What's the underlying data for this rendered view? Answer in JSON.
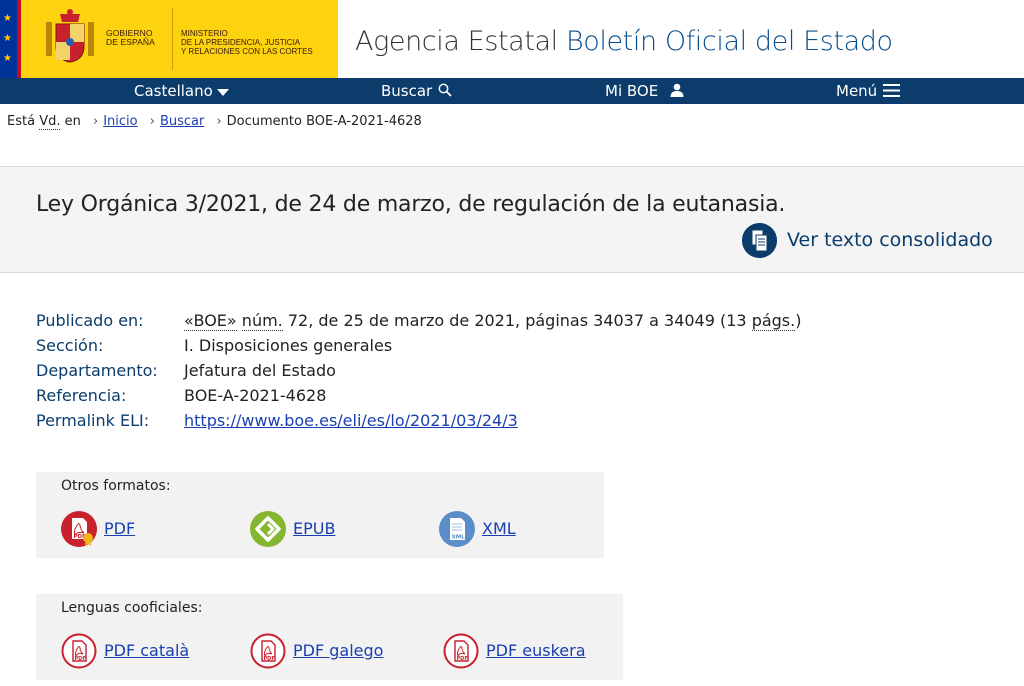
{
  "header": {
    "gobierno": [
      "GOBIERNO",
      "DE ESPAÑA"
    ],
    "ministerio": [
      "MINISTERIO",
      "DE LA PRESIDENCIA, JUSTICIA",
      "Y RELACIONES CON LAS CORTES"
    ],
    "title_plain": "Agencia Estatal ",
    "title_blue": "Boletín Oficial del Estado"
  },
  "nav": {
    "language": "Castellano",
    "search": "Buscar",
    "my_boe": "Mi BOE",
    "menu": "Menú"
  },
  "breadcrumb": {
    "prefix_1": "Está ",
    "abbr": "Vd.",
    "prefix_2": " en",
    "items": [
      "Inicio",
      "Buscar"
    ],
    "current": "Documento BOE-A-2021-4628"
  },
  "document": {
    "title": "Ley Orgánica 3/2021, de 24 de marzo, de regulación de la eutanasia.",
    "consolidated_link": "Ver texto consolidado"
  },
  "metadata": {
    "published": {
      "label": "Publicado en:",
      "boe": "«BOE»",
      "num_abbr": "núm.",
      "text": " 72, de 25 de marzo de 2021, páginas 34037 a 34049 (13 ",
      "pags_abbr": "págs.",
      "close": ")"
    },
    "section": {
      "label": "Sección:",
      "value": "I. Disposiciones generales"
    },
    "department": {
      "label": "Departamento:",
      "value": "Jefatura del Estado"
    },
    "reference": {
      "label": "Referencia:",
      "value": "BOE-A-2021-4628"
    },
    "permalink": {
      "label": "Permalink ELI:",
      "value": "https://www.boe.es/eli/es/lo/2021/03/24/3"
    }
  },
  "other_formats": {
    "title": "Otros formatos:",
    "items": [
      "PDF",
      "EPUB",
      "XML"
    ]
  },
  "co_official": {
    "title": "Lenguas cooficiales:",
    "items": [
      "PDF català",
      "PDF galego",
      "PDF euskera"
    ]
  },
  "colors": {
    "navy": "#0b3c6b",
    "gov_yellow": "#fdd20f",
    "pdf_red": "#c8202c",
    "epub_green": "#86b52f",
    "xml_blue": "#5b8ec9",
    "link_blue": "#1a3fb0"
  }
}
